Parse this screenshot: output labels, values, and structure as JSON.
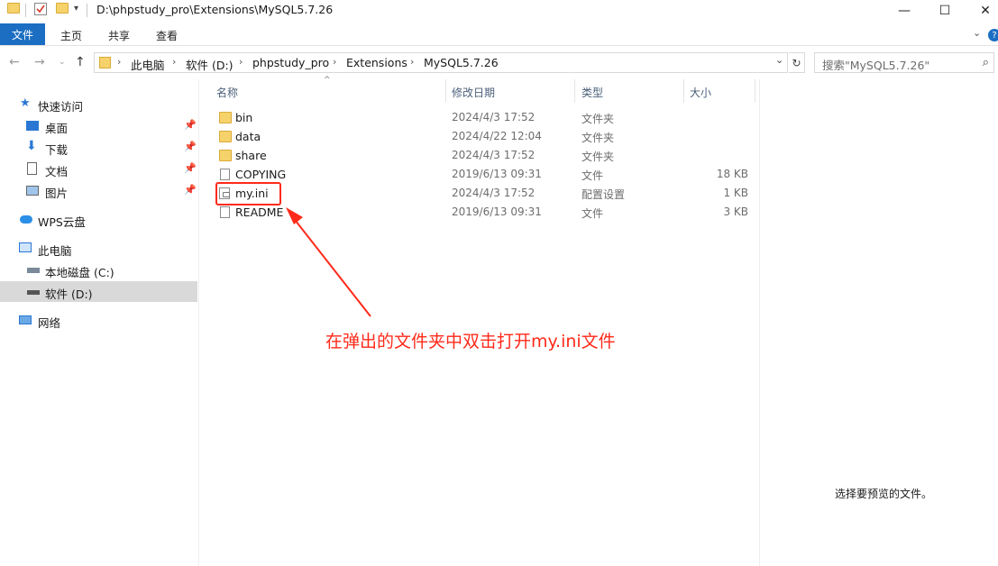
{
  "window": {
    "title": "D:\\phpstudy_pro\\Extensions\\MySQL5.7.26",
    "minimize": "—",
    "maximize": "☐",
    "close": "✕"
  },
  "ribbon": {
    "tabs": [
      "文件",
      "主页",
      "共享",
      "查看"
    ],
    "help": "?"
  },
  "address": {
    "breadcrumbs": [
      "此电脑",
      "软件 (D:)",
      "phpstudy_pro",
      "Extensions",
      "MySQL5.7.26"
    ],
    "search_placeholder": "搜索\"MySQL5.7.26\""
  },
  "sidebar": {
    "items": [
      {
        "label": "快速访问",
        "icon": "star-icon",
        "pinned": false
      },
      {
        "label": "桌面",
        "icon": "desktop-icon",
        "pinned": true
      },
      {
        "label": "下载",
        "icon": "download-icon",
        "pinned": true
      },
      {
        "label": "文档",
        "icon": "document-icon",
        "pinned": true
      },
      {
        "label": "图片",
        "icon": "picture-icon",
        "pinned": true
      },
      {
        "label": "WPS云盘",
        "icon": "cloud-icon",
        "pinned": false
      },
      {
        "label": "此电脑",
        "icon": "computer-icon",
        "pinned": false
      },
      {
        "label": "本地磁盘 (C:)",
        "icon": "drive-c-icon",
        "pinned": false
      },
      {
        "label": "软件 (D:)",
        "icon": "drive-d-icon",
        "pinned": false,
        "selected": true
      },
      {
        "label": "网络",
        "icon": "network-icon",
        "pinned": false
      }
    ]
  },
  "columns": {
    "name": "名称",
    "date": "修改日期",
    "type": "类型",
    "size": "大小"
  },
  "files": [
    {
      "name": "bin",
      "date": "2024/4/3 17:52",
      "type": "文件夹",
      "size": "",
      "icon": "folder-icon"
    },
    {
      "name": "data",
      "date": "2024/4/22 12:04",
      "type": "文件夹",
      "size": "",
      "icon": "folder-icon"
    },
    {
      "name": "share",
      "date": "2024/4/3 17:52",
      "type": "文件夹",
      "size": "",
      "icon": "folder-icon"
    },
    {
      "name": "COPYING",
      "date": "2019/6/13 09:31",
      "type": "文件",
      "size": "18 KB",
      "icon": "file-icon"
    },
    {
      "name": "my.ini",
      "date": "2024/4/3 17:52",
      "type": "配置设置",
      "size": "1 KB",
      "icon": "ini-file-icon"
    },
    {
      "name": "README",
      "date": "2019/6/13 09:31",
      "type": "文件",
      "size": "3 KB",
      "icon": "file-icon"
    }
  ],
  "annotation": {
    "text": "在弹出的文件夹中双击打开my.ini文件",
    "color": "#ff2a1a"
  },
  "preview": {
    "empty_text": "选择要预览的文件。"
  },
  "colors": {
    "accent": "#1b6ec2",
    "folder": "#f6d26b",
    "selection": "#d9d9d9"
  }
}
